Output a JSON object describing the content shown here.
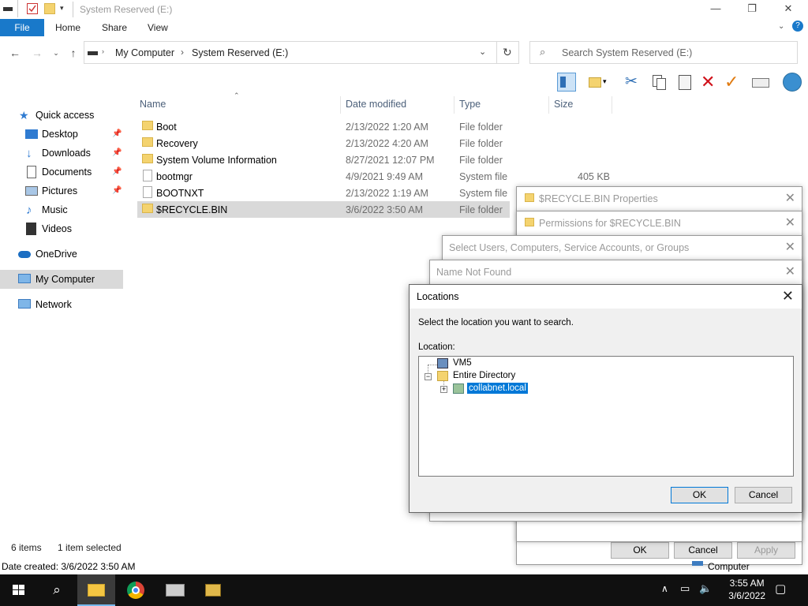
{
  "window": {
    "title": "System Reserved (E:)",
    "controls": {
      "minimize": "—",
      "maximize": "❐",
      "close": "✕"
    }
  },
  "ribbon": {
    "file": "File",
    "tabs": [
      "Home",
      "Share",
      "View"
    ],
    "help": "?"
  },
  "address": {
    "segments": [
      "My Computer",
      "System Reserved (E:)"
    ],
    "separator": ">",
    "search_placeholder": "Search System Reserved (E:)"
  },
  "navpane": {
    "items": [
      {
        "label": "Quick access",
        "icon": "star-icon"
      },
      {
        "label": "Desktop",
        "icon": "desktop-icon",
        "pinned": true
      },
      {
        "label": "Downloads",
        "icon": "downloads-icon",
        "pinned": true
      },
      {
        "label": "Documents",
        "icon": "documents-icon",
        "pinned": true
      },
      {
        "label": "Pictures",
        "icon": "pictures-icon",
        "pinned": true
      },
      {
        "label": "Music",
        "icon": "music-icon"
      },
      {
        "label": "Videos",
        "icon": "videos-icon"
      },
      {
        "label": "OneDrive",
        "icon": "onedrive-icon"
      },
      {
        "label": "My Computer",
        "icon": "computer-icon",
        "selected": true
      },
      {
        "label": "Network",
        "icon": "network-icon"
      }
    ]
  },
  "filelist": {
    "columns": [
      "Name",
      "Date modified",
      "Type",
      "Size"
    ],
    "rows": [
      {
        "name": "Boot",
        "date": "2/13/2022 1:20 AM",
        "type": "File folder",
        "size": "",
        "kind": "folder"
      },
      {
        "name": "Recovery",
        "date": "2/13/2022 4:20 AM",
        "type": "File folder",
        "size": "",
        "kind": "folder"
      },
      {
        "name": "System Volume Information",
        "date": "8/27/2021 12:07 PM",
        "type": "File folder",
        "size": "",
        "kind": "folder"
      },
      {
        "name": "bootmgr",
        "date": "4/9/2021 9:49 AM",
        "type": "System file",
        "size": "405 KB",
        "kind": "file"
      },
      {
        "name": "BOOTNXT",
        "date": "2/13/2022 1:19 AM",
        "type": "System file",
        "size": "",
        "kind": "file"
      },
      {
        "name": "$RECYCLE.BIN",
        "date": "3/6/2022 3:50 AM",
        "type": "File folder",
        "size": "",
        "kind": "folder",
        "selected": true
      }
    ]
  },
  "status": {
    "items_count": "6 items",
    "selected": "1 item selected",
    "date_created": "Date created: 3/6/2022 3:50 AM"
  },
  "dialogs": {
    "properties": {
      "title": "$RECYCLE.BIN Properties",
      "ok": "OK",
      "cancel": "Cancel",
      "apply": "Apply",
      "partial_text": "Computer"
    },
    "permissions": {
      "title": "Permissions for $RECYCLE.BIN"
    },
    "select_users": {
      "title": "Select Users, Computers, Service Accounts, or Groups"
    },
    "name_not_found": {
      "title": "Name Not Found"
    },
    "locations": {
      "title": "Locations",
      "instruction": "Select the location you want to search.",
      "location_label": "Location:",
      "tree": [
        {
          "label": "VM5",
          "level": 0
        },
        {
          "label": "Entire Directory",
          "level": 0,
          "expanded": true
        },
        {
          "label": "collabnet.local",
          "level": 1,
          "selected": true
        }
      ],
      "ok": "OK",
      "cancel": "Cancel"
    }
  },
  "taskbar": {
    "time": "3:55 AM",
    "date": "3/6/2022",
    "apps": [
      "start-icon",
      "search-icon",
      "file-explorer-icon",
      "chrome-icon",
      "server-manager-icon",
      "lock-folder-icon"
    ]
  }
}
